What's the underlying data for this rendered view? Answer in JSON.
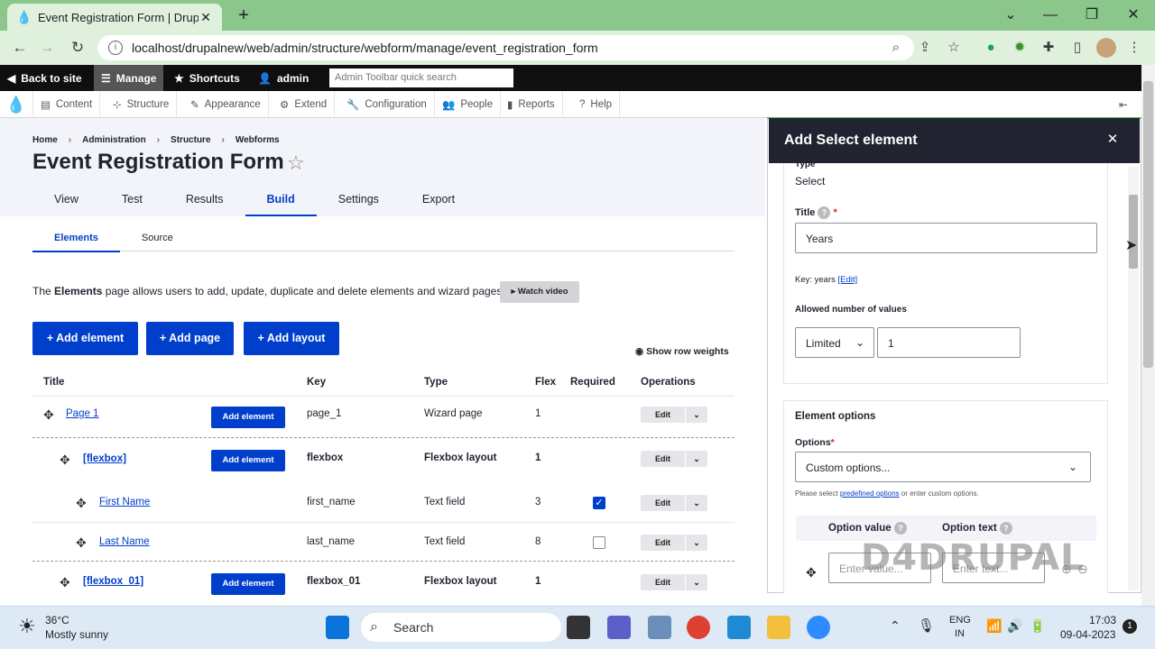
{
  "browser": {
    "tab_title": "Event Registration Form | Drupal",
    "tab_close": "✕",
    "new_tab": "+",
    "url": "localhost/drupalnew/web/admin/structure/webform/manage/event_registration_form",
    "window_controls": [
      "⌄",
      "—",
      "❐",
      "✕"
    ]
  },
  "toolbar": {
    "back": "Back to site",
    "manage": "Manage",
    "shortcuts": "Shortcuts",
    "user": "admin",
    "search_placeholder": "Admin Toolbar quick search"
  },
  "tray": [
    "Content",
    "Structure",
    "Appearance",
    "Extend",
    "Configuration",
    "People",
    "Reports",
    "Help"
  ],
  "breadcrumb": [
    "Home",
    "Administration",
    "Structure",
    "Webforms"
  ],
  "page_title": "Event Registration Form",
  "primary_tabs": [
    "View",
    "Test",
    "Results",
    "Build",
    "Settings",
    "Export"
  ],
  "secondary_tabs": [
    "Elements",
    "Source"
  ],
  "description": {
    "pre": "The ",
    "bold": "Elements",
    "post": " page allows users to add, update, duplicate and delete elements and wizard pages."
  },
  "watch_video": "▸ Watch video",
  "buttons": {
    "add_element": "+ Add element",
    "add_page": "+ Add page",
    "add_layout": "+ Add layout"
  },
  "show_row_weights": "Show row weights",
  "table": {
    "headers": [
      "Title",
      "Key",
      "Type",
      "Flex",
      "Required",
      "Operations"
    ],
    "add_element_label": "Add element",
    "edit_label": "Edit",
    "rows": [
      {
        "title": "Page 1",
        "key": "page_1",
        "type": "Wizard page",
        "flex": "1"
      },
      {
        "title": "[flexbox]",
        "key": "flexbox",
        "type": "Flexbox layout",
        "flex": "1"
      },
      {
        "title": "First Name",
        "key": "first_name",
        "type": "Text field",
        "flex": "3",
        "required": true
      },
      {
        "title": "Last Name",
        "key": "last_name",
        "type": "Text field",
        "flex": "8",
        "required": false
      },
      {
        "title": "[flexbox_01]",
        "key": "flexbox_01",
        "type": "Flexbox layout",
        "flex": "1"
      }
    ]
  },
  "dialog": {
    "title": "Add Select element",
    "close": "✕",
    "type_label": "Type",
    "type_value": "Select",
    "title_label": "Title",
    "title_value": "Years",
    "key_text": "Key: years",
    "key_edit": "[Edit]",
    "allowed_label": "Allowed number of values",
    "allowed_mode": "Limited",
    "allowed_count": "1",
    "element_options": "Element options",
    "options_label": "Options",
    "options_value": "Custom options...",
    "options_help_pre": "Please select ",
    "options_help_link": "predefined options",
    "options_help_post": " or enter custom options.",
    "option_value_header": "Option value",
    "option_text_header": "Option text",
    "option_value_placeholder": "Enter value...",
    "option_text_placeholder": "Enter text..."
  },
  "watermark": "D4DRUPAL",
  "taskbar": {
    "temp": "36°C",
    "weather": "Mostly sunny",
    "search": "Search",
    "lang1": "ENG",
    "lang2": "IN",
    "time": "17:03",
    "date": "09-04-2023",
    "badge": "1"
  },
  "colors": {
    "accent": "#003ecc",
    "chrome": "#8bc68a",
    "toolbar": "#0f0f0f"
  }
}
